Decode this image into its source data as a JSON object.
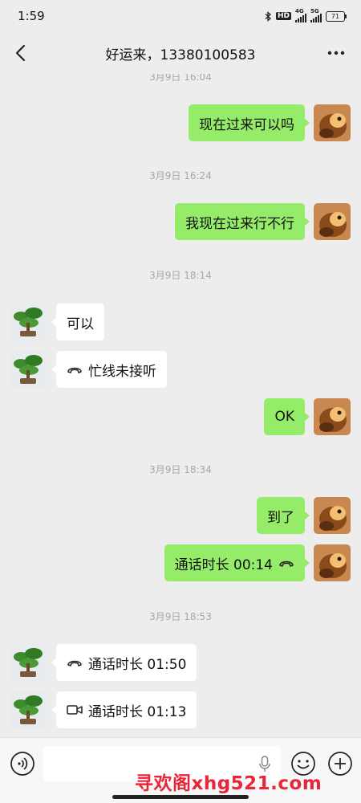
{
  "status_bar": {
    "time": "1:59",
    "hd": "HD",
    "net1": "4G",
    "net2": "5G",
    "battery": "71"
  },
  "header": {
    "title": "好运来，13380100583"
  },
  "messages": [
    {
      "type": "time",
      "text": "3月9日 16:04"
    },
    {
      "type": "msg",
      "side": "me",
      "text": "现在过来可以吗"
    },
    {
      "type": "time",
      "text": "3月9日 16:24"
    },
    {
      "type": "msg",
      "side": "me",
      "text": "我现在过来行不行"
    },
    {
      "type": "time",
      "text": "3月9日 18:14"
    },
    {
      "type": "msg",
      "side": "peer",
      "text": "可以"
    },
    {
      "type": "msg",
      "side": "peer",
      "icon": "phone-hangup-icon",
      "text": "忙线未接听"
    },
    {
      "type": "msg",
      "side": "me",
      "text": "OK"
    },
    {
      "type": "time",
      "text": "3月9日 18:34"
    },
    {
      "type": "msg",
      "side": "me",
      "text": "到了"
    },
    {
      "type": "msg",
      "side": "me",
      "icon_after": "phone-hangup-icon",
      "text": "通话时长 00:14"
    },
    {
      "type": "time",
      "text": "3月9日 18:53"
    },
    {
      "type": "msg",
      "side": "peer",
      "icon": "phone-hangup-icon",
      "text": "通话时长 01:50"
    },
    {
      "type": "msg",
      "side": "peer",
      "icon": "video-camera-icon",
      "text": "通话时长 01:13"
    }
  ],
  "input_bar": {
    "value": "",
    "placeholder": ""
  },
  "watermark": "寻欢阁xhg521.com",
  "colors": {
    "bubble_me": "#95ec69",
    "bubble_peer": "#ffffff",
    "background": "#ededed",
    "watermark": "#e8263a"
  }
}
